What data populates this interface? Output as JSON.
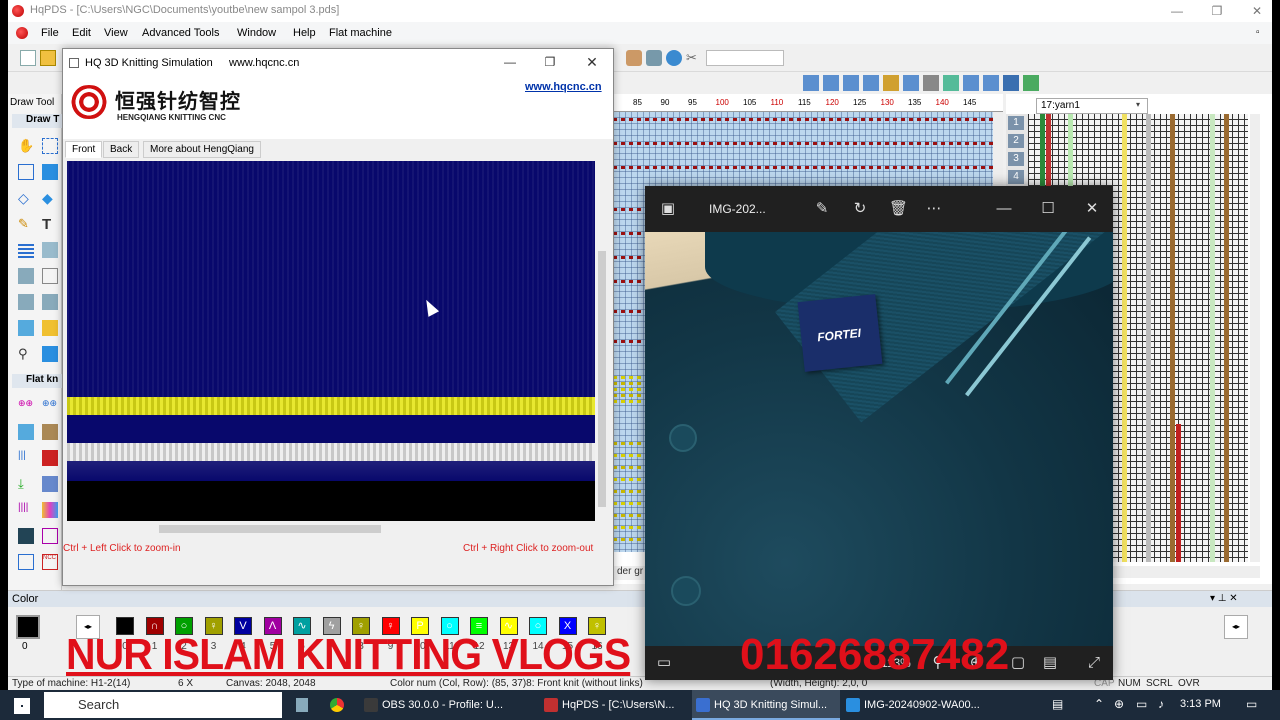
{
  "app": {
    "title": "HqPDS - [C:\\Users\\NGC\\Documents\\youtbe\\new sampol 3.pds]",
    "menu": [
      "File",
      "Edit",
      "View",
      "Advanced Tools",
      "Window",
      "Help",
      "Flat machine"
    ],
    "left_panel": {
      "header": "Draw Tool",
      "section_draw": "Draw T",
      "section_flat": "Flat kn"
    },
    "ruler_ticks": [
      "85",
      "90",
      "95",
      "100",
      "105",
      "110",
      "115",
      "120",
      "125",
      "130",
      "135",
      "140",
      "145"
    ],
    "yarn_select": "17:yarn1",
    "yarn_rows": [
      "1",
      "2",
      "3",
      "4"
    ],
    "grid_footer": "der gr",
    "color_panel": {
      "title": "Color",
      "current_index": "0",
      "swatches": [
        {
          "label": "0",
          "color": "#000000",
          "glyph": ""
        },
        {
          "label": "1",
          "color": "#a00000",
          "glyph": "∩"
        },
        {
          "label": "2",
          "color": "#00a000",
          "glyph": "○"
        },
        {
          "label": "3",
          "color": "#a0a000",
          "glyph": "♀"
        },
        {
          "label": "4",
          "color": "#0000a0",
          "glyph": "V"
        },
        {
          "label": "5",
          "color": "#a000a0",
          "glyph": "Λ"
        },
        {
          "label": "6",
          "color": "#00a0a0",
          "glyph": "∿"
        },
        {
          "label": "7",
          "color": "#a0a0a0",
          "glyph": "ϟ"
        },
        {
          "label": "8",
          "color": "#a0a000",
          "glyph": "♀"
        },
        {
          "label": "9",
          "color": "#ff0000",
          "glyph": "♀"
        },
        {
          "label": "10",
          "color": "#ffff00",
          "glyph": "P"
        },
        {
          "label": "11",
          "color": "#00ffff",
          "glyph": "○"
        },
        {
          "label": "12",
          "color": "#00ff00",
          "glyph": "≡"
        },
        {
          "label": "13",
          "color": "#ffff00",
          "glyph": "∿"
        },
        {
          "label": "14",
          "color": "#00ffff",
          "glyph": "○"
        },
        {
          "label": "15",
          "color": "#0000ff",
          "glyph": "X"
        },
        {
          "label": "16",
          "color": "#c0c000",
          "glyph": "♀"
        }
      ]
    },
    "status": {
      "machine": "Type of machine: H1-2(14)",
      "zoom": "6 X",
      "canvas": "Canvas: 2048, 2048",
      "color_num": "Color num  (Col, Row): (85, 37)8: Front knit (without links)",
      "size": "(Width, Height): 2,0, 0",
      "keys": [
        "CAP",
        "NUM",
        "SCRL",
        "OVR"
      ]
    }
  },
  "sim_window": {
    "title": "HQ 3D Knitting Simulation",
    "url": "www.hqcnc.cn",
    "link": "www.hqcnc.cn",
    "logo_cn": "恒强针纺智控",
    "logo_en": "HENGQIANG KNITTING CNC",
    "tabs": [
      "Front",
      "Back",
      "More about HengQiang"
    ],
    "hint_left": "Ctrl + Left Click to zoom-in",
    "hint_right": "Ctrl + Right Click to zoom-out",
    "colors": {
      "field": "#08086c",
      "stripe_yellow": "#d8d81c",
      "stripe_white": "#d8d8d8"
    }
  },
  "photo_viewer": {
    "title": "IMG-202...",
    "zoom": "113%",
    "label_text": "FORTEI"
  },
  "overlay": {
    "line1": "NUR ISLAM KNITTING VLOGS",
    "line2": "01626887482",
    "color": "#e0101a"
  },
  "taskbar": {
    "search_placeholder": "Search",
    "items": [
      {
        "label": "OBS 30.0.0 - Profile: U...",
        "active": false
      },
      {
        "label": "HqPDS - [C:\\Users\\N...",
        "active": false
      },
      {
        "label": "HQ 3D Knitting Simul...",
        "active": true
      },
      {
        "label": "IMG-20240902-WA00...",
        "active": false
      }
    ],
    "time": "3:13 PM"
  }
}
